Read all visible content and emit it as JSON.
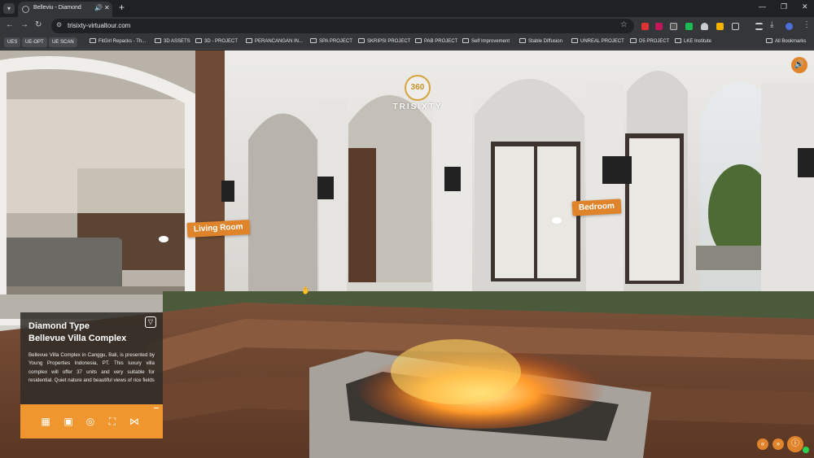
{
  "browser": {
    "tab_title": "Belleviu - Diamond",
    "url": "trisixty-virtualtour.com",
    "bookmarks": [
      {
        "label": "UES",
        "chip": true
      },
      {
        "label": "UE-OPT",
        "chip": true
      },
      {
        "label": "UE SCAN",
        "chip": true
      },
      {
        "label": "FitGirl Repacks - Th...",
        "chip": false
      },
      {
        "label": "3D ASSETS",
        "chip": false
      },
      {
        "label": "3D - PROJECT",
        "chip": false
      },
      {
        "label": "PERANCANGAN IN...",
        "chip": false
      },
      {
        "label": "SPA PROJECT",
        "chip": false
      },
      {
        "label": "SKRIPSI PROJECT",
        "chip": false
      },
      {
        "label": "PAB PROJECT",
        "chip": false
      },
      {
        "label": "Self Improvement",
        "chip": false
      },
      {
        "label": "Stable Diffusion",
        "chip": false
      },
      {
        "label": "UNREAL PROJECT",
        "chip": false
      },
      {
        "label": "D5 PROJECT",
        "chip": false
      },
      {
        "label": "LKE Institute",
        "chip": false
      }
    ],
    "all_bookmarks": "All Bookmarks"
  },
  "tour": {
    "logo_ring": "360",
    "logo_text": "TRISIXTY",
    "hotspots": {
      "living_room": "Living Room",
      "bedroom": "Bedroom"
    },
    "info": {
      "type": "Diamond Type",
      "name": "Bellevue Villa Complex",
      "description": "Bellevue Villa Complex in Canggu, Bali, is presented by Young Properties Indonesia, PT. This luxury villa complex will offer 37 units and very suitable for residential. Quiet nature and beautiful views of rice fields"
    }
  },
  "icons": {
    "sound": "speaker-icon",
    "collapse": "chevron-down-icon",
    "menu": [
      "grid-icon",
      "floorplan-icon",
      "vr-headset-icon",
      "fullscreen-icon",
      "share-icon"
    ],
    "nav": [
      "prev-arrow-icon",
      "next-arrow-icon",
      "info-icon"
    ]
  },
  "colors": {
    "accent": "#E0842C",
    "panel": "#302C28",
    "menu": "#F0962E"
  }
}
